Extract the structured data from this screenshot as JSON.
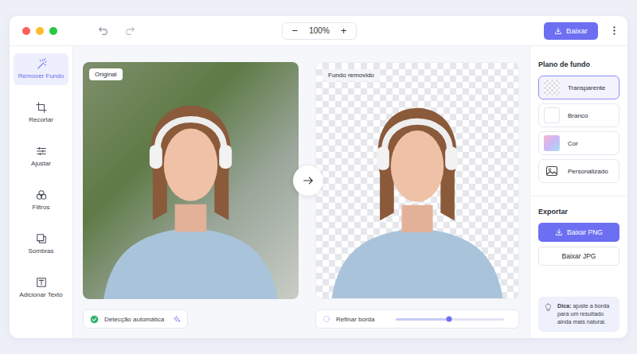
{
  "toolbar": {
    "zoom": "100%",
    "zoom_out": "−",
    "zoom_in": "+",
    "download": "Baixar"
  },
  "sidebar": {
    "items": [
      {
        "label": "Remover Fundo",
        "selected": true
      },
      {
        "label": "Recortar",
        "selected": false
      },
      {
        "label": "Ajustar",
        "selected": false
      },
      {
        "label": "Filtros",
        "selected": false
      },
      {
        "label": "Sombras",
        "selected": false
      },
      {
        "label": "Adicionar Texto",
        "selected": false
      }
    ]
  },
  "panels": {
    "original": {
      "label": "Original"
    },
    "result": {
      "label": "Fundo removido"
    }
  },
  "auto_detect": {
    "label": "Detecção automática",
    "checked": true
  },
  "refine": {
    "label": "Refinar borda",
    "level": 0.49
  },
  "background": {
    "title": "Plano de fundo",
    "options": [
      {
        "label": "Transparente",
        "selected": true,
        "kind": "transparent"
      },
      {
        "label": "Branco",
        "selected": false,
        "kind": "white"
      },
      {
        "label": "Cor",
        "selected": false,
        "kind": "color"
      },
      {
        "label": "Personalizado",
        "selected": false,
        "kind": "image"
      }
    ]
  },
  "export": {
    "title": "Exportar",
    "buttons": [
      {
        "label": "Baixar PNG",
        "kind": "primary"
      },
      {
        "label": "Baixar JPG",
        "kind": "secondary"
      }
    ]
  },
  "tip": {
    "label": "Dica:",
    "text": "ajuste a borda para um resultado ainda mais natural."
  }
}
